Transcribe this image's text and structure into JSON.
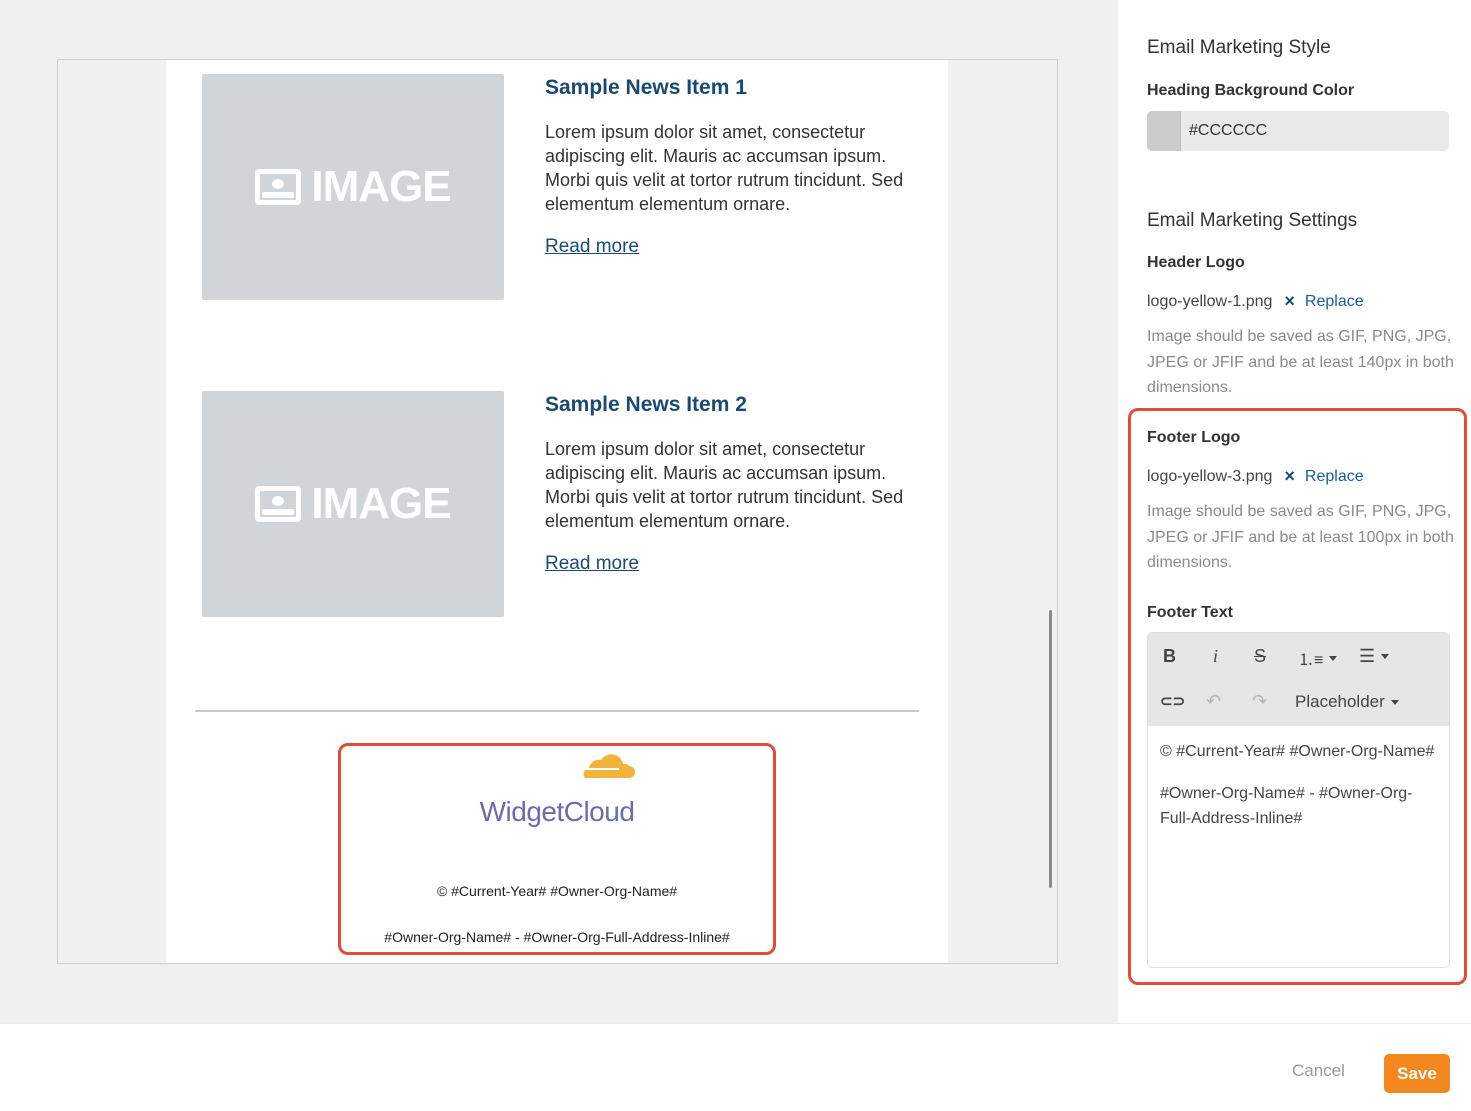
{
  "preview": {
    "news_items": [
      {
        "image_label": "IMAGE",
        "title": "Sample News Item 1",
        "body": "Lorem ipsum dolor sit amet, consectetur adipiscing elit. Mauris ac accumsan ipsum. Morbi quis velit at tortor rutrum tincidunt. Sed elementum elementum ornare.",
        "link": "Read more"
      },
      {
        "image_label": "IMAGE",
        "title": "Sample News Item 2",
        "body": "Lorem ipsum dolor sit amet, consectetur adipiscing elit. Mauris ac accumsan ipsum. Morbi quis velit at tortor rutrum tincidunt. Sed elementum elementum ornare.",
        "link": "Read more"
      }
    ],
    "footer": {
      "logo_text": "WidgetCloud",
      "line1": "© #Current-Year# #Owner-Org-Name#",
      "line2": "#Owner-Org-Name# - #Owner-Org-Full-Address-Inline#"
    }
  },
  "panel": {
    "style_title": "Email Marketing Style",
    "heading_bg_label": "Heading Background Color",
    "heading_bg_value": "#CCCCCC",
    "settings_title": "Email Marketing Settings",
    "header_logo": {
      "label": "Header Logo",
      "file": "logo-yellow-1.png",
      "remove": "×",
      "replace": "Replace",
      "hint": "Image should be saved as GIF, PNG, JPG, JPEG or JFIF and be at least 140px in both dimensions."
    },
    "footer_logo": {
      "label": "Footer Logo",
      "file": "logo-yellow-3.png",
      "remove": "×",
      "replace": "Replace",
      "hint": "Image should be saved as GIF, PNG, JPG, JPEG or JFIF and be at least 100px in both dimensions."
    },
    "footer_text": {
      "label": "Footer Text",
      "toolbar": {
        "bold": "B",
        "italic": "i",
        "strike": "S",
        "ordered_list": "⒈≡",
        "bullet_list": "☰",
        "link": "⊂⊃",
        "undo": "↶",
        "redo": "↷",
        "placeholder": "Placeholder"
      },
      "content_line1": "© #Current-Year# #Owner-Org-Name#",
      "content_line2": "#Owner-Org-Name# - #Owner-Org-Full-Address-Inline#"
    }
  },
  "actions": {
    "cancel": "Cancel",
    "save": "Save"
  },
  "colors": {
    "accent": "#f5871f",
    "link": "#1a4a73",
    "highlight": "#de4d38",
    "logo_cloud": "#f0b43c",
    "logo_text": "#6c6bb0"
  },
  "icons": [
    "image-icon",
    "close-icon",
    "bold-icon",
    "italic-icon",
    "strikethrough-icon",
    "ordered-list-icon",
    "bullet-list-icon",
    "link-icon",
    "undo-icon",
    "redo-icon",
    "cloud-logo-icon"
  ]
}
